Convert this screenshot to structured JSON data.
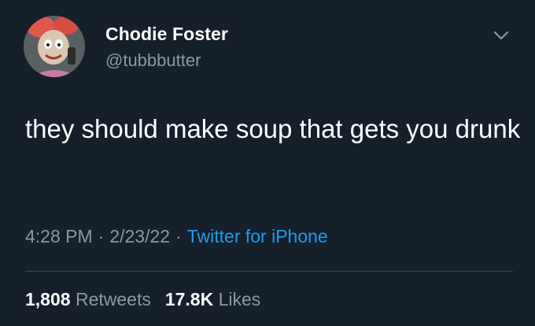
{
  "user": {
    "display_name": "Chodie Foster",
    "handle": "@tubbbutter",
    "avatar_icon": "cartoon-character-avatar"
  },
  "tweet": {
    "text": "they should make soup that gets you drunk",
    "time": "4:28 PM",
    "date": "2/23/22",
    "separator": "·",
    "source": "Twitter for iPhone"
  },
  "stats": {
    "retweets_count": "1,808",
    "retweets_label": "Retweets",
    "likes_count": "17.8K",
    "likes_label": "Likes"
  },
  "colors": {
    "background": "#15202b",
    "primary_text": "#ffffff",
    "secondary_text": "#8b98a5",
    "link": "#1d9bf0",
    "divider": "#38444d"
  }
}
